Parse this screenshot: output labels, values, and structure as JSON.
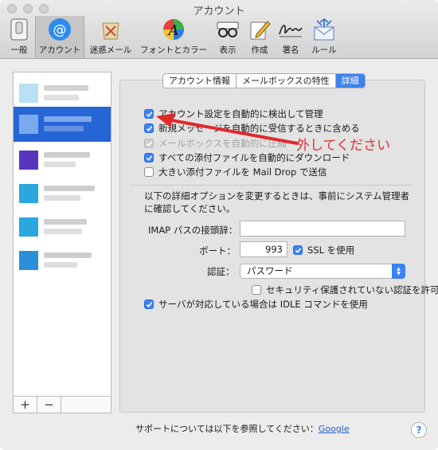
{
  "window": {
    "title": "アカウント"
  },
  "toolbar": {
    "items": [
      {
        "label": "一般",
        "icon": "general-switch-icon"
      },
      {
        "label": "アカウント",
        "icon": "at-sign-icon"
      },
      {
        "label": "迷惑メール",
        "icon": "junk-bin-icon"
      },
      {
        "label": "フォントとカラー",
        "icon": "font-color-icon"
      },
      {
        "label": "表示",
        "icon": "glasses-icon"
      },
      {
        "label": "作成",
        "icon": "compose-pencil-icon"
      },
      {
        "label": "署名",
        "icon": "signature-icon"
      },
      {
        "label": "ルール",
        "icon": "rules-envelope-icon"
      }
    ]
  },
  "accounts": {
    "items": [
      {
        "selected": false,
        "logo_color": "#7fc7ea"
      },
      {
        "selected": true,
        "logo_color": "#7aa9ee"
      },
      {
        "selected": false,
        "logo_color": "#5a34c0"
      },
      {
        "selected": false,
        "logo_color": "#2aa7df"
      },
      {
        "selected": false,
        "logo_color": "#2aa7df"
      },
      {
        "selected": false,
        "logo_color": "#2a8ed8"
      }
    ],
    "add_label": "+",
    "remove_label": "−"
  },
  "tabs": {
    "items": [
      "アカウント情報",
      "メールボックスの特性",
      "詳細"
    ],
    "active": "詳細"
  },
  "options": {
    "auto_detect": {
      "label": "アカウント設定を自動的に検出して管理",
      "checked": true
    },
    "include_fetch": {
      "label": "新規メッセージを自動的に受信するときに含める",
      "checked": true
    },
    "compact_mailboxes": {
      "label": "メールボックスを自動的に圧縮",
      "checked": true,
      "disabled": true
    },
    "download_attachments": {
      "label": "すべての添付ファイルを自動的にダウンロード",
      "checked": true
    },
    "mail_drop": {
      "label": "大きい添付ファイルを Mail Drop で送信",
      "checked": false
    }
  },
  "advanced_note": "以下の詳細オプションを変更するときは、事前にシステム管理者に確認してください。",
  "imap_prefix": {
    "label": "IMAP パスの接頭辞：",
    "value": ""
  },
  "port": {
    "label": "ポート：",
    "value": "993"
  },
  "ssl": {
    "label": "SSL を使用",
    "checked": true
  },
  "auth": {
    "label": "認証：",
    "value": "パスワード"
  },
  "insecure_auth": {
    "label": "セキュリティ保護されていない認証を許可",
    "checked": false
  },
  "idle": {
    "label": "サーバが対応している場合は IDLE コマンドを使用",
    "checked": true
  },
  "support": {
    "text": "サポートについては以下を参照してください：",
    "link": "Google"
  },
  "help_label": "?",
  "annotation": {
    "text": "外してください",
    "color": "#e03030"
  }
}
